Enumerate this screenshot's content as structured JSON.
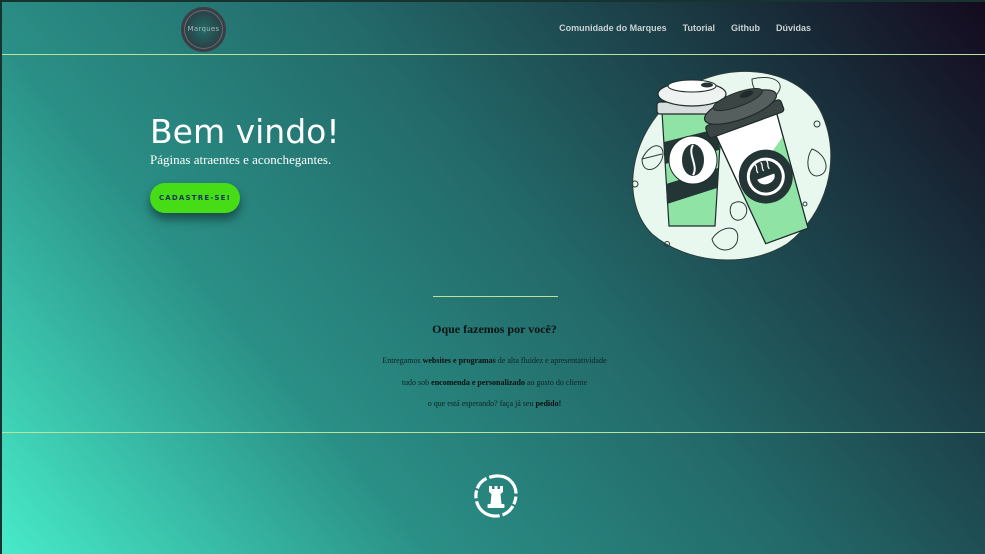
{
  "header": {
    "logo_text": "Marques",
    "nav": [
      "Comunidade do Marques",
      "Tutorial",
      "Github",
      "Dúvidas"
    ]
  },
  "hero": {
    "title": "Bem vindo!",
    "subtitle": "Páginas atraentes e aconchegantes.",
    "cta_label": "CADASTRE-SE!"
  },
  "about": {
    "title": "Oque fazemos por você?",
    "line1": {
      "pre": "Entregamos ",
      "bold": "websites e programas",
      "post": " de alta fluidez e apresentatividade"
    },
    "line2": {
      "pre": "tudo sob ",
      "bold": "encomenda e personalizado",
      "post": " ao gosto do cliente"
    },
    "line3": {
      "pre": "o que está esperando? faça já seu ",
      "bold": "pedido!",
      "post": ""
    }
  },
  "colors": {
    "accent_green": "#46dd17",
    "divider": "#b9e49a",
    "mint": "#8fe3a5"
  },
  "icons": {
    "illustration": "coffee-cups-illustration",
    "footer": "chess-rook-logo-icon"
  }
}
